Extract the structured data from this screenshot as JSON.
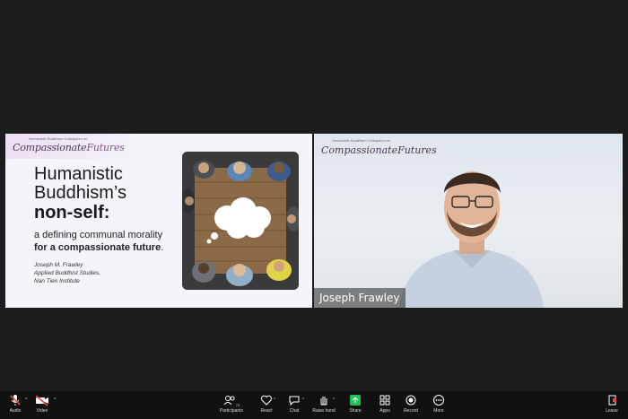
{
  "slide": {
    "brand_small": "Humanistic Buddhism Colloquium on",
    "brand_part1": "Compassionate",
    "brand_part2": "Futures",
    "title_line1": "Humanistic",
    "title_line2": "Buddhism’s",
    "title_line3": "non-self:",
    "subtitle_line1": "a defining communal morality",
    "subtitle_line2": "for a compassionate future",
    "subtitle_end": ".",
    "author": "Joseph M. Frawley",
    "affiliation1": "Applied Buddhist Studies,",
    "affiliation2": "Nan Tien Institute"
  },
  "speaker": {
    "brand_small": "Humanistic Buddhism Colloquium on",
    "brand_part1": "Compassionate",
    "brand_part2": "Futures",
    "name": "Joseph Frawley"
  },
  "toolbar": {
    "audio": {
      "label": "Audio",
      "icon": "microphone-muted-icon"
    },
    "video": {
      "label": "Video",
      "icon": "video-camera-muted-icon"
    },
    "participants": {
      "label": "Participants",
      "icon": "participants-icon",
      "count": "73"
    },
    "react": {
      "label": "React",
      "icon": "heart-icon"
    },
    "chat": {
      "label": "Chat",
      "icon": "chat-bubble-icon"
    },
    "raise_hand": {
      "label": "Raise hand",
      "icon": "hand-icon"
    },
    "share": {
      "label": "Share",
      "icon": "share-screen-icon"
    },
    "apps": {
      "label": "Apps",
      "icon": "apps-icon"
    },
    "record": {
      "label": "Record",
      "icon": "record-icon"
    },
    "more": {
      "label": "More",
      "icon": "more-icon"
    },
    "leave": {
      "label": "Leave",
      "icon": "leave-icon"
    }
  },
  "colors": {
    "background": "#1c1c1c",
    "toolbar": "#111111",
    "muted_red": "#e5484d",
    "share_green": "#1fbf5a",
    "brand_purple": "#4b3a5a"
  }
}
